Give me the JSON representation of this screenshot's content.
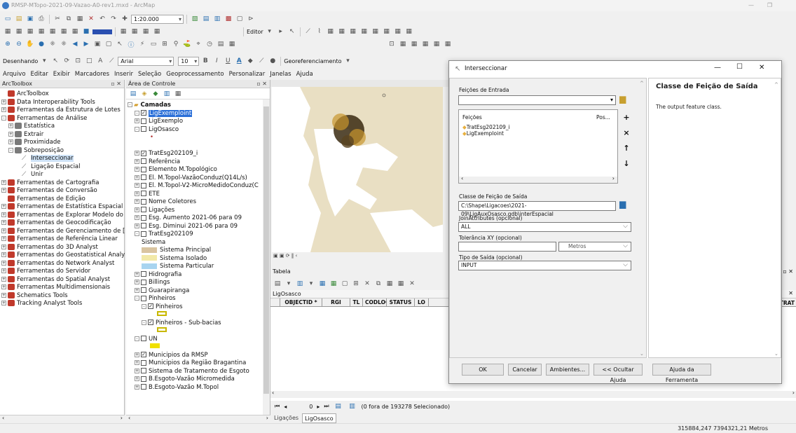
{
  "window": {
    "title": "RMSP-MTopo-2021-09-Vazao-A0-rev1.mxd - ArcMap"
  },
  "toolbar": {
    "scale": "1:20.000",
    "editor_label": "Editor",
    "drawing_label": "Desenhando",
    "font_name": "Arial",
    "font_size": "10",
    "bold": "B",
    "italic": "I",
    "underline": "U",
    "font_color": "A",
    "georef_label": "Georeferenciamento"
  },
  "menu": [
    "Arquivo",
    "Editar",
    "Exibir",
    "Marcadores",
    "Inserir",
    "Seleção",
    "Geoprocessamento",
    "Personalizar",
    "Janelas",
    "Ajuda"
  ],
  "arctoolbox": {
    "title": "ArcToolbox",
    "items": [
      {
        "label": "ArcToolbox",
        "level": 0,
        "exp": ""
      },
      {
        "label": "Data Interoperability Tools",
        "level": 0,
        "exp": "+"
      },
      {
        "label": "Ferramentas da Estrutura de Lotes",
        "level": 0,
        "exp": "+"
      },
      {
        "label": "Ferramentas de Análise",
        "level": 0,
        "exp": "-"
      },
      {
        "label": "Estatística",
        "level": 1,
        "exp": "+"
      },
      {
        "label": "Extrair",
        "level": 1,
        "exp": "+"
      },
      {
        "label": "Proximidade",
        "level": 1,
        "exp": "+"
      },
      {
        "label": "Sobreposição",
        "level": 1,
        "exp": "-"
      },
      {
        "label": "Interseccionar",
        "level": 2,
        "exp": "",
        "tool": true,
        "selected": true
      },
      {
        "label": "Ligação Espacial",
        "level": 2,
        "exp": "",
        "tool": true
      },
      {
        "label": "Unir",
        "level": 2,
        "exp": "",
        "tool": true
      },
      {
        "label": "Ferramentas de Cartografia",
        "level": 0,
        "exp": "+"
      },
      {
        "label": "Ferramentas de Conversão",
        "level": 0,
        "exp": "+"
      },
      {
        "label": "Ferramentas de Edição",
        "level": 0,
        "exp": ""
      },
      {
        "label": "Ferramentas de Estatística Espacial",
        "level": 0,
        "exp": "+"
      },
      {
        "label": "Ferramentas de Explorar Modelo do",
        "level": 0,
        "exp": "+"
      },
      {
        "label": "Ferramentas de Geocodificação",
        "level": 0,
        "exp": "+"
      },
      {
        "label": "Ferramentas de Gerenciamento de [",
        "level": 0,
        "exp": "+"
      },
      {
        "label": "Ferramentas de Referência Linear",
        "level": 0,
        "exp": "+"
      },
      {
        "label": "Ferramentas do 3D Analyst",
        "level": 0,
        "exp": "+"
      },
      {
        "label": "Ferramentas do Geostatistical Analy",
        "level": 0,
        "exp": "+"
      },
      {
        "label": "Ferramentas do Network Analyst",
        "level": 0,
        "exp": "+"
      },
      {
        "label": "Ferramentas do Servidor",
        "level": 0,
        "exp": "+"
      },
      {
        "label": "Ferramentas do Spatial Analyst",
        "level": 0,
        "exp": "+"
      },
      {
        "label": "Ferramentas Multidimensionais",
        "level": 0,
        "exp": "+"
      },
      {
        "label": "Schematics Tools",
        "level": 0,
        "exp": "+"
      },
      {
        "label": "Tracking Analyst Tools",
        "level": 0,
        "exp": "+"
      }
    ]
  },
  "toc": {
    "title": "Área de Controle",
    "items": [
      {
        "label": "Camadas",
        "level": 0,
        "exp": "-",
        "chk": "",
        "bold": true
      },
      {
        "label": "LigExemploint",
        "level": 1,
        "exp": "-",
        "chk": "on",
        "selected": true
      },
      {
        "label": "LigExemplo",
        "level": 1,
        "exp": "+",
        "chk": "off"
      },
      {
        "label": "LigOsasco",
        "level": 1,
        "exp": "-",
        "chk": "off"
      },
      {
        "label": "•",
        "level": 2,
        "exp": "",
        "chk": "",
        "dot": true
      },
      {
        "label": "",
        "level": 1,
        "exp": "",
        "chk": ""
      },
      {
        "label": "TratEsg202109_i",
        "level": 1,
        "exp": "+",
        "chk": "on"
      },
      {
        "label": "Referência",
        "level": 1,
        "exp": "+",
        "chk": "off"
      },
      {
        "label": "Elemento M.Topológico",
        "level": 1,
        "exp": "+",
        "chk": "off"
      },
      {
        "label": "El. M.Topol-VazãoConduz(Q14L/s)",
        "level": 1,
        "exp": "+",
        "chk": "off"
      },
      {
        "label": "El. M.Topol-V2-MicroMedidoConduz(C",
        "level": 1,
        "exp": "+",
        "chk": "off"
      },
      {
        "label": "ETE",
        "level": 1,
        "exp": "+",
        "chk": "off"
      },
      {
        "label": "Nome Coletores",
        "level": 1,
        "exp": "+",
        "chk": "off"
      },
      {
        "label": "Ligações",
        "level": 1,
        "exp": "+",
        "chk": "off"
      },
      {
        "label": "Esg. Aumento 2021-06 para 09",
        "level": 1,
        "exp": "+",
        "chk": "off"
      },
      {
        "label": "Esg. Diminui 2021-06 para 09",
        "level": 1,
        "exp": "+",
        "chk": "off"
      },
      {
        "label": "TratEsg202109",
        "level": 1,
        "exp": "-",
        "chk": "off"
      },
      {
        "label": "Sistema",
        "level": 2,
        "exp": "",
        "chk": ""
      },
      {
        "label": "Sistema Principal",
        "level": 2,
        "exp": "",
        "chk": "",
        "swatch": "#d9c4a0"
      },
      {
        "label": "Sistema Isolado",
        "level": 2,
        "exp": "",
        "chk": "",
        "swatch": "#f2e9a8"
      },
      {
        "label": "Sistema Particular",
        "level": 2,
        "exp": "",
        "chk": "",
        "swatch": "#a8d4f0"
      },
      {
        "label": "Hidrografia",
        "level": 1,
        "exp": "+",
        "chk": "off"
      },
      {
        "label": "Billings",
        "level": 1,
        "exp": "+",
        "chk": "off"
      },
      {
        "label": "Guarapiranga",
        "level": 1,
        "exp": "+",
        "chk": "off"
      },
      {
        "label": "Pinheiros",
        "level": 1,
        "exp": "-",
        "chk": "off"
      },
      {
        "label": "Pinheiros",
        "level": 2,
        "exp": "-",
        "chk": "on"
      },
      {
        "label": "",
        "level": 3,
        "exp": "",
        "chk": "",
        "box": "#c8b800"
      },
      {
        "label": "Pinheiros - Sub-bacias",
        "level": 2,
        "exp": "-",
        "chk": "on"
      },
      {
        "label": "",
        "level": 3,
        "exp": "",
        "chk": "",
        "box": "#c8b800"
      },
      {
        "label": "UN",
        "level": 1,
        "exp": "-",
        "chk": "off"
      },
      {
        "label": "",
        "level": 2,
        "exp": "",
        "chk": "",
        "fill": "#f0e000"
      },
      {
        "label": "Municipios da RMSP",
        "level": 1,
        "exp": "+",
        "chk": "on"
      },
      {
        "label": "Municipios da Região Bragantina",
        "level": 1,
        "exp": "+",
        "chk": "off"
      },
      {
        "label": "Sistema de Tratamento de Esgoto",
        "level": 1,
        "exp": "+",
        "chk": "off"
      },
      {
        "label": "B.Esgoto-Vazão Micromedida",
        "level": 1,
        "exp": "+",
        "chk": "off"
      },
      {
        "label": "B.Esgoto-Vazão M.Topol",
        "level": 1,
        "exp": "+",
        "chk": "off"
      }
    ]
  },
  "table": {
    "title": "Tabela",
    "layer": "LigOsasco",
    "columns": [
      "OBJECTID *",
      "RGI",
      "TL",
      "CODLOG",
      "STATUS",
      "LO"
    ],
    "extra_column": "D_TRAT",
    "record_text": "0",
    "selection_text": "(0 fora de 193278 Selecionado)",
    "tabs": [
      "Ligações",
      "LigOsasco"
    ]
  },
  "dialog": {
    "title": "Interseccionar",
    "input_label": "Feições de Entrada",
    "input_value": "",
    "list_col1": "Feições",
    "list_col2": "Pos...",
    "features": [
      "TratEsg202109_i",
      "LigExemploint"
    ],
    "output_label": "Classe de Feição de Saída",
    "output_value": "C:\\Shape\\Ligacoes\\2021-09\\LigAuxOsasco.gdb\\interEspacial",
    "join_label": "JoinAttributes (opcional)",
    "join_value": "ALL",
    "tol_label": "Tolerância XY (opcional)",
    "tol_value": "",
    "tol_unit": "Metros",
    "type_label": "Tipo de Saída (opcional)",
    "type_value": "INPUT",
    "ok": "OK",
    "cancel": "Cancelar",
    "env": "Ambientes...",
    "hide_help": "<< Ocultar Ajuda",
    "tool_help": "Ajuda da Ferramenta",
    "help_title": "Classe de Feição de Saída",
    "help_text": "The output feature class.",
    "min": "—",
    "max": "☐",
    "close": "✕"
  },
  "status": {
    "coords": "315884,247  7394321,21 Metros"
  }
}
